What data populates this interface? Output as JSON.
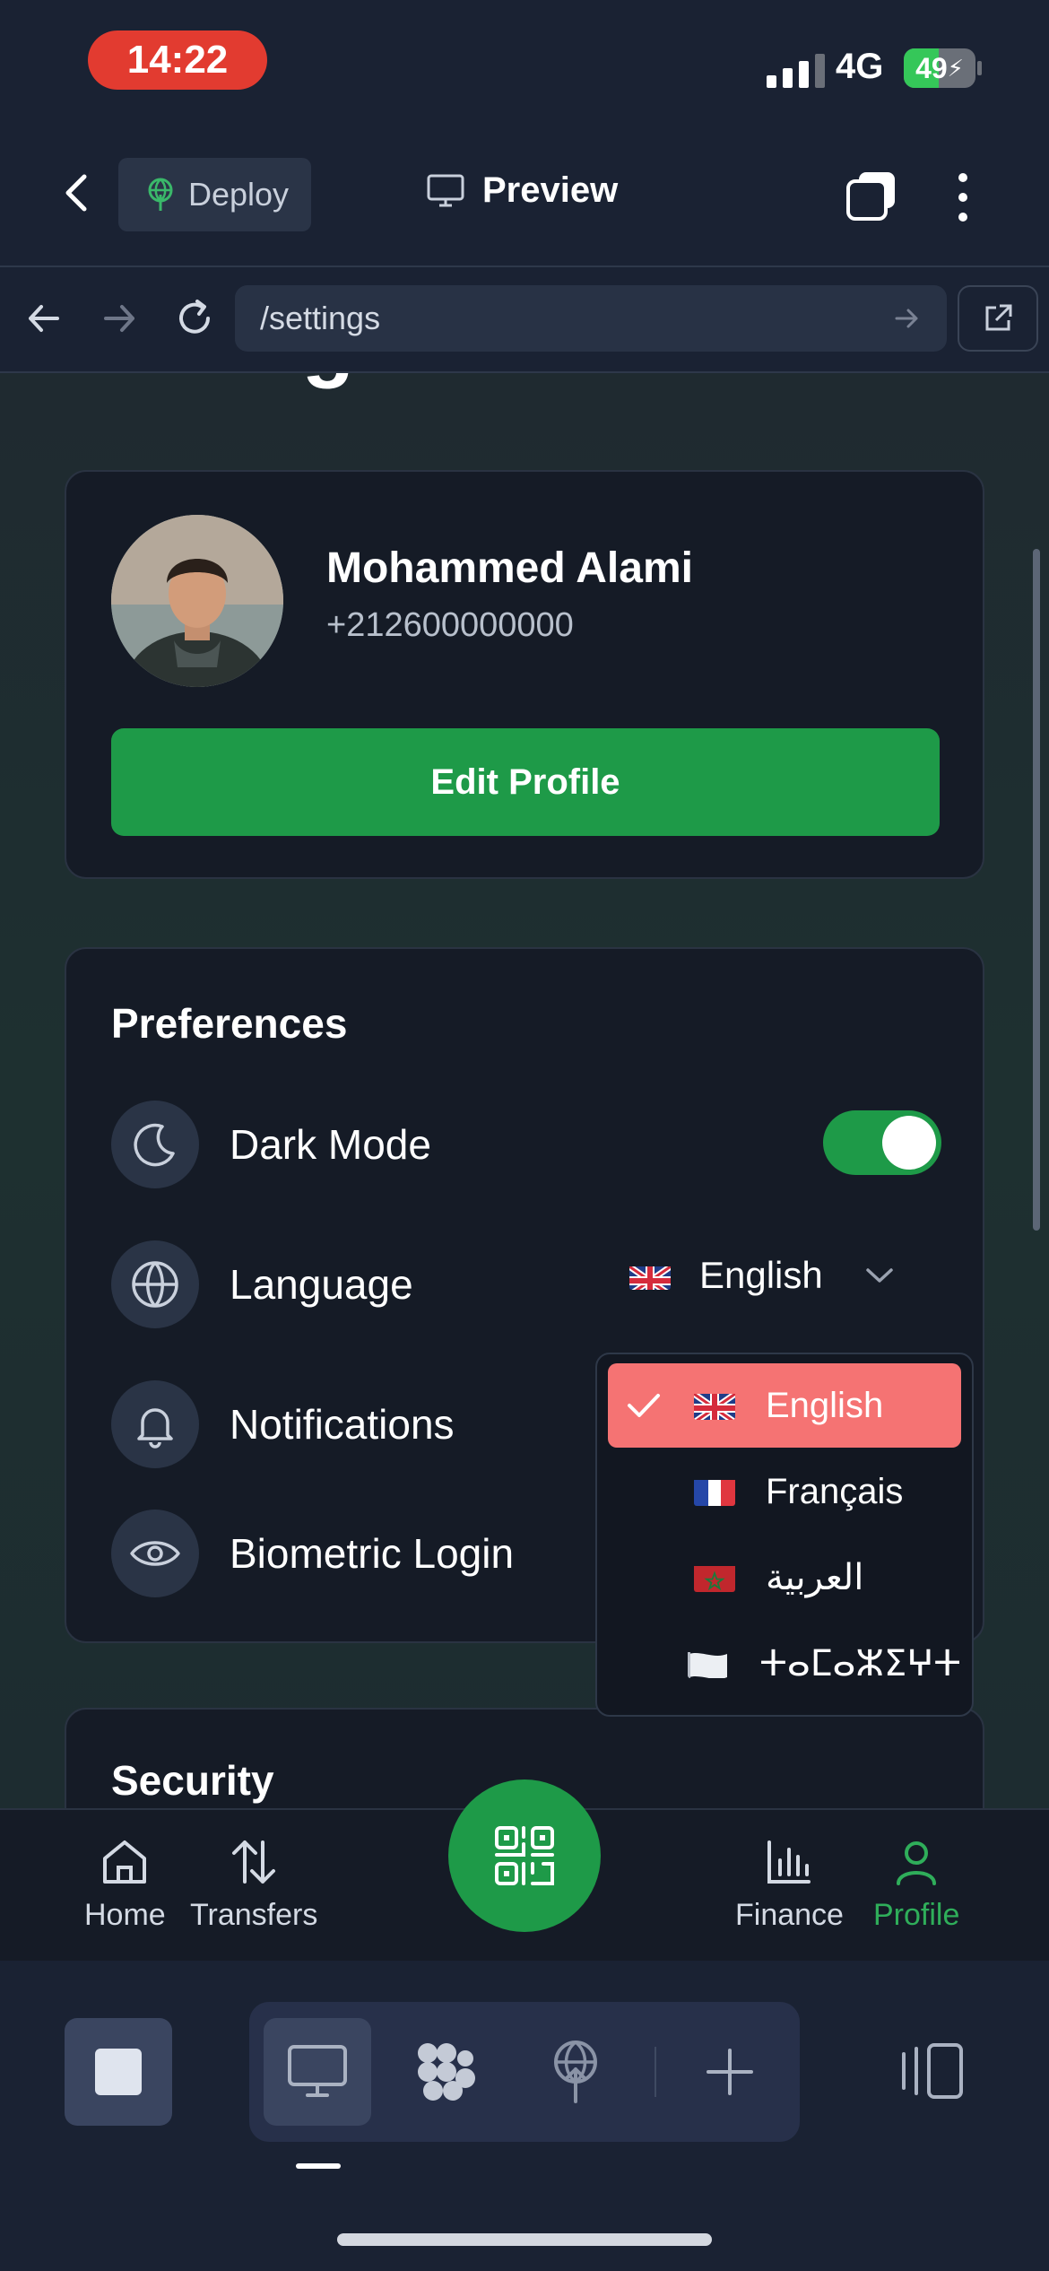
{
  "status_bar": {
    "time": "14:22",
    "network": "4G",
    "battery": "49",
    "battery_level": 0.49
  },
  "toolbar": {
    "deploy_label": "Deploy",
    "preview_label": "Preview"
  },
  "browser": {
    "url": "/settings"
  },
  "page": {
    "heading": "Settings"
  },
  "profile": {
    "name": "Mohammed Alami",
    "phone": "+212600000000",
    "edit_label": "Edit Profile"
  },
  "preferences": {
    "title": "Preferences",
    "dark_mode": "Dark Mode",
    "dark_mode_on": true,
    "language": "Language",
    "language_value": "English",
    "notifications": "Notifications",
    "biometric": "Biometric Login"
  },
  "language_options": [
    {
      "label": "English",
      "selected": true
    },
    {
      "label": "Français",
      "selected": false
    },
    {
      "label": "العربية",
      "selected": false
    },
    {
      "label": "ⵜⴰⵎⴰⵣⵉⵖⵜ",
      "selected": false
    }
  ],
  "security": {
    "title": "Security"
  },
  "bottom_nav": {
    "home": "Home",
    "transfers": "Transfers",
    "finance": "Finance",
    "profile": "Profile",
    "active": "Profile"
  },
  "colors": {
    "accent_green": "#1e9a48",
    "selected_red": "#f57373",
    "background": "#1a2233"
  }
}
